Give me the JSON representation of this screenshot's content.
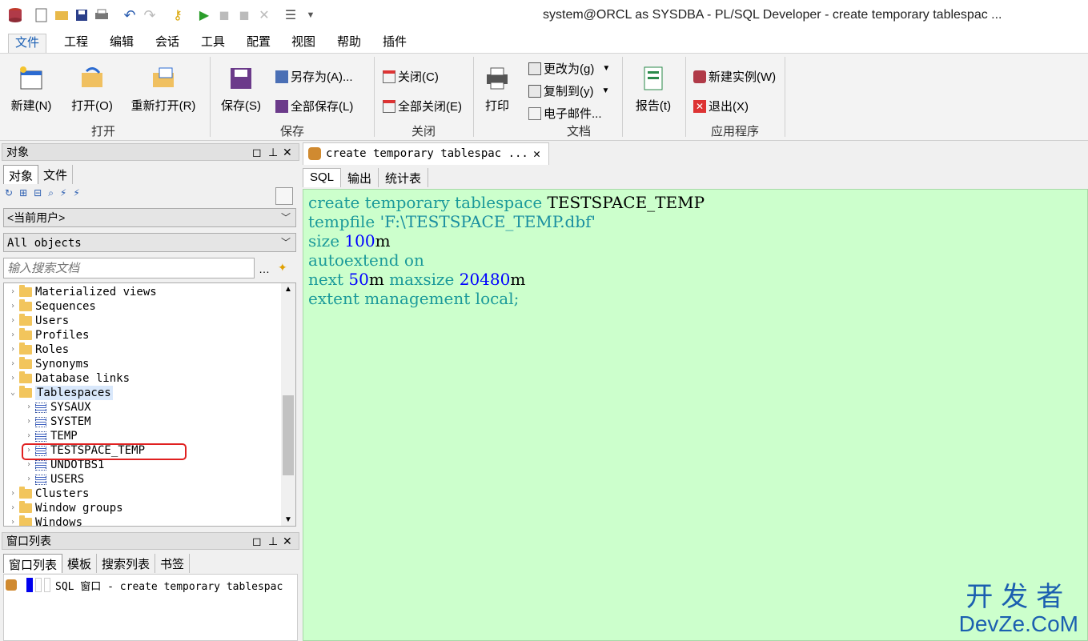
{
  "window": {
    "title": "system@ORCL as SYSDBA - PL/SQL Developer - create temporary tablespac ..."
  },
  "menu": [
    "文件",
    "工程",
    "编辑",
    "会话",
    "工具",
    "配置",
    "视图",
    "帮助",
    "插件"
  ],
  "ribbon": {
    "open": {
      "new": "新建(N)",
      "open": "打开(O)",
      "reopen": "重新打开(R)",
      "group": "打开"
    },
    "save": {
      "save": "保存(S)",
      "save_as": "另存为(A)...",
      "save_all": "全部保存(L)",
      "group": "保存"
    },
    "close": {
      "close": "关闭(C)",
      "close_all": "全部关闭(E)",
      "group": "关闭"
    },
    "doc": {
      "print": "打印",
      "change_to": "更改为(g)",
      "copy_to": "复制到(y)",
      "email": "电子邮件...",
      "group": "文档"
    },
    "app": {
      "report": "报告(t)",
      "new_instance": "新建实例(W)",
      "exit": "退出(X)",
      "group": "应用程序"
    }
  },
  "object_panel": {
    "title": "对象",
    "tabs": [
      "对象",
      "文件"
    ],
    "user_combo": "<当前用户>",
    "filter_combo": "All objects",
    "search_placeholder": "输入搜索文档"
  },
  "tree": [
    {
      "label": "Materialized views",
      "type": "folder"
    },
    {
      "label": "Sequences",
      "type": "folder"
    },
    {
      "label": "Users",
      "type": "folder"
    },
    {
      "label": "Profiles",
      "type": "folder"
    },
    {
      "label": "Roles",
      "type": "folder"
    },
    {
      "label": "Synonyms",
      "type": "folder"
    },
    {
      "label": "Database links",
      "type": "folder"
    },
    {
      "label": "Tablespaces",
      "type": "folder-open"
    },
    {
      "label": "SYSAUX",
      "type": "ts"
    },
    {
      "label": "SYSTEM",
      "type": "ts"
    },
    {
      "label": "TEMP",
      "type": "ts"
    },
    {
      "label": "TESTSPACE_TEMP",
      "type": "ts"
    },
    {
      "label": "UNDOTBS1",
      "type": "ts"
    },
    {
      "label": "USERS",
      "type": "ts"
    },
    {
      "label": "Clusters",
      "type": "folder"
    },
    {
      "label": "Window groups",
      "type": "folder"
    },
    {
      "label": "Windows",
      "type": "folder"
    }
  ],
  "window_list": {
    "title": "窗口列表",
    "tabs": [
      "窗口列表",
      "模板",
      "搜索列表",
      "书签"
    ],
    "item": "SQL 窗口 - create temporary tablespac"
  },
  "editor": {
    "tab": "create temporary tablespac ...",
    "subtabs": [
      "SQL",
      "输出",
      "统计表"
    ],
    "lines": [
      [
        [
          "kw",
          "create temporary tablespace "
        ],
        [
          "id",
          "TESTSPACE_TEMP"
        ]
      ],
      [
        [
          "kw",
          "tempfile "
        ],
        [
          "str",
          "'F:\\TESTSPACE_TEMP.dbf'"
        ]
      ],
      [
        [
          "kw",
          "size "
        ],
        [
          "num",
          "100"
        ],
        [
          "id",
          "m"
        ]
      ],
      [
        [
          "kw",
          "autoextend on"
        ]
      ],
      [
        [
          "kw",
          "next "
        ],
        [
          "num",
          "50"
        ],
        [
          "id",
          "m "
        ],
        [
          "kw",
          "maxsize "
        ],
        [
          "num",
          "20480"
        ],
        [
          "id",
          "m"
        ]
      ],
      [
        [
          "kw",
          "extent management local;"
        ]
      ]
    ]
  },
  "watermark": {
    "line1": "开发者",
    "line2": "DevZe.CoM"
  },
  "colors": {
    "editor_bg": "#ccffcc",
    "highlight": "#e02020"
  }
}
